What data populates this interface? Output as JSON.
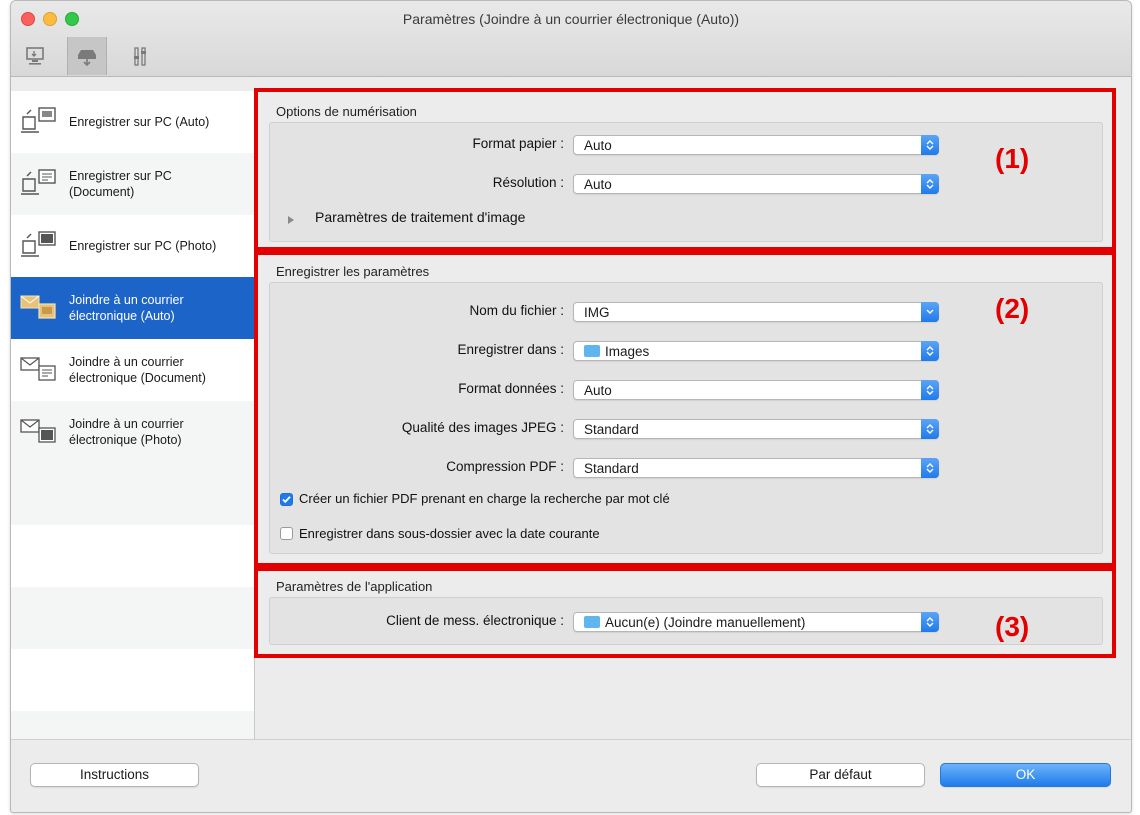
{
  "window": {
    "title": "Paramètres (Joindre à un courrier électronique (Auto))",
    "tabs": [
      {
        "icon": "scan-from-computer-icon"
      },
      {
        "icon": "scan-from-panel-icon"
      },
      {
        "icon": "general-settings-icon"
      }
    ]
  },
  "sidebar": {
    "items": [
      {
        "label": "Enregistrer sur PC (Auto)",
        "icon": "save-to-pc-auto-icon"
      },
      {
        "label": "Enregistrer sur PC (Document)",
        "icon": "save-to-pc-document-icon"
      },
      {
        "label": "Enregistrer sur PC (Photo)",
        "icon": "save-to-pc-photo-icon"
      },
      {
        "label": "Joindre à un courrier électronique (Auto)",
        "icon": "attach-email-auto-icon",
        "selected": true
      },
      {
        "label": "Joindre à un courrier électronique (Document)",
        "icon": "attach-email-document-icon"
      },
      {
        "label": "Joindre à un courrier électronique (Photo)",
        "icon": "attach-email-photo-icon"
      }
    ]
  },
  "scan_options": {
    "title": "Options de numérisation",
    "paper_size_label": "Format papier :",
    "paper_size_value": "Auto",
    "resolution_label": "Résolution :",
    "resolution_value": "Auto",
    "image_processing_label": "Paramètres de traitement d'image",
    "marker": "(1)"
  },
  "save_settings": {
    "title": "Enregistrer les paramètres",
    "filename_label": "Nom du fichier :",
    "filename_value": "IMG",
    "save_in_label": "Enregistrer dans :",
    "save_in_value": "Images",
    "data_format_label": "Format données :",
    "data_format_value": "Auto",
    "jpeg_quality_label": "Qualité des images JPEG :",
    "jpeg_quality_value": "Standard",
    "pdf_compression_label": "Compression PDF :",
    "pdf_compression_value": "Standard",
    "keyword_pdf_label": "Créer un fichier PDF prenant en charge la recherche par mot clé",
    "keyword_pdf_checked": true,
    "subfolder_label": "Enregistrer dans sous-dossier avec la date courante",
    "subfolder_checked": false,
    "marker": "(2)"
  },
  "app_settings": {
    "title": "Paramètres de l'application",
    "email_client_label": "Client de mess. électronique :",
    "email_client_value": "Aucun(e) (Joindre manuellement)",
    "marker": "(3)"
  },
  "footer": {
    "instructions_label": "Instructions",
    "defaults_label": "Par défaut",
    "ok_label": "OK"
  },
  "colors": {
    "highlight_red": "#e30000",
    "selection_blue": "#1c64c8",
    "popup_blue": "#1f7bea"
  }
}
